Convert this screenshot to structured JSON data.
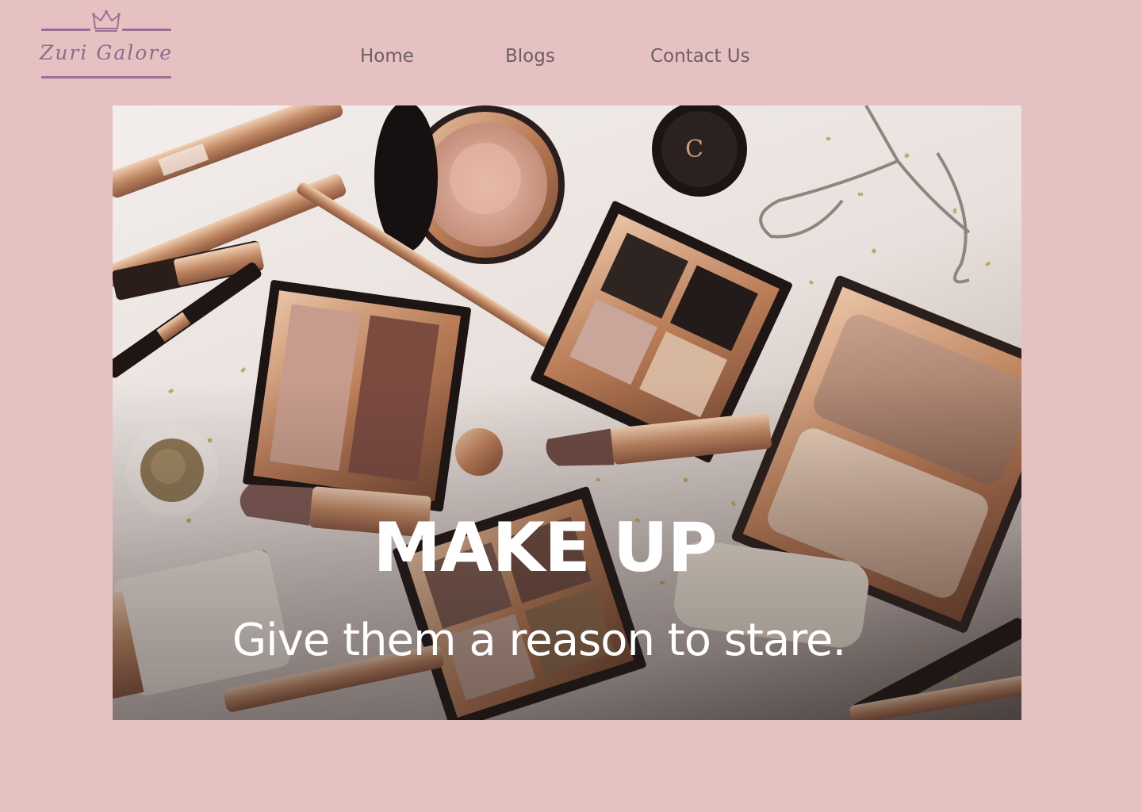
{
  "brand": {
    "name": "Zuri Galore",
    "icon": "crown-icon",
    "color": "#9B6F93"
  },
  "nav": {
    "items": [
      {
        "label": "Home"
      },
      {
        "label": "Blogs"
      },
      {
        "label": "Contact Us"
      }
    ]
  },
  "hero": {
    "title": "MAKE UP",
    "subtitle": "Give them a reason to stare."
  },
  "colors": {
    "page_background": "#E6C1C2",
    "nav_text": "#6E5E62",
    "hero_text": "#FFFFFF"
  }
}
